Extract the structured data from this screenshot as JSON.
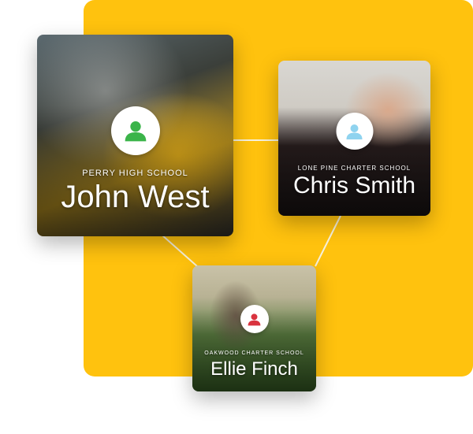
{
  "colors": {
    "accent_yellow": "#FFC20E",
    "connector": "#f6f0da",
    "avatar_green": "#3bb44a",
    "avatar_light_blue": "#8fd3ef",
    "avatar_red": "#d9333f"
  },
  "cards": [
    {
      "school": "PERRY HIGH SCHOOL",
      "name": "John West",
      "avatar_icon": "user-icon",
      "avatar_color": "green"
    },
    {
      "school": "LONE PINE CHARTER SCHOOL",
      "name": "Chris Smith",
      "avatar_icon": "user-icon",
      "avatar_color": "light-blue"
    },
    {
      "school": "OAKWOOD CHARTER SCHOOL",
      "name": "Ellie Finch",
      "avatar_icon": "user-icon",
      "avatar_color": "red"
    }
  ]
}
